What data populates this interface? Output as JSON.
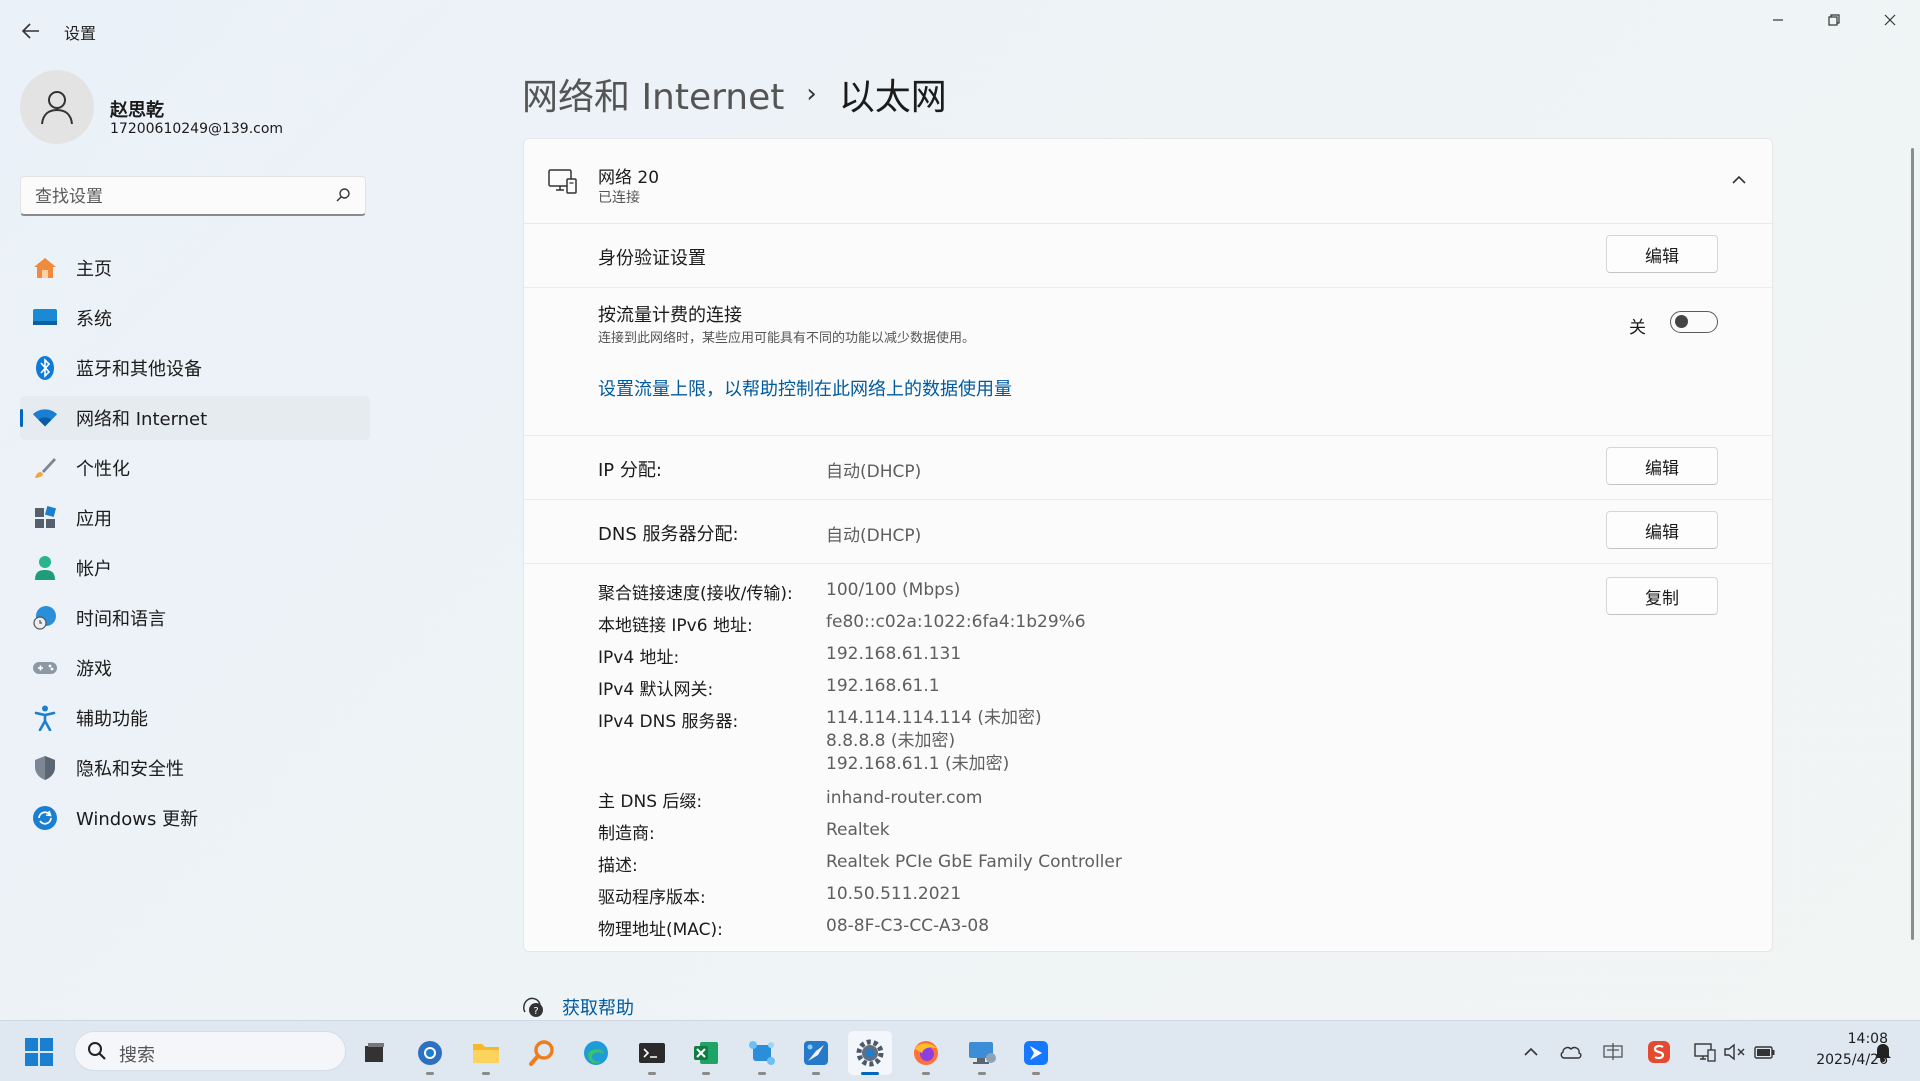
{
  "app": {
    "title": "设置"
  },
  "user": {
    "name": "赵思乾",
    "email": "17200610249@139.com"
  },
  "search": {
    "placeholder": "查找设置"
  },
  "nav": {
    "items": [
      {
        "label": "主页"
      },
      {
        "label": "系统"
      },
      {
        "label": "蓝牙和其他设备"
      },
      {
        "label": "网络和 Internet"
      },
      {
        "label": "个性化"
      },
      {
        "label": "应用"
      },
      {
        "label": "帐户"
      },
      {
        "label": "时间和语言"
      },
      {
        "label": "游戏"
      },
      {
        "label": "辅助功能"
      },
      {
        "label": "隐私和安全性"
      },
      {
        "label": "Windows 更新"
      }
    ],
    "active": "网络和 Internet"
  },
  "breadcrumb": {
    "parent": "网络和 Internet",
    "separator": "›",
    "current": "以太网"
  },
  "network": {
    "name": "网络 20",
    "status": "已连接"
  },
  "auth": {
    "label": "身份验证设置",
    "button": "编辑"
  },
  "metered": {
    "label": "按流量计费的连接",
    "description": "连接到此网络时，某些应用可能具有不同的功能以减少数据使用。",
    "toggle_label": "关",
    "enabled": false,
    "link": "设置流量上限，以帮助控制在此网络上的数据使用量"
  },
  "ip": {
    "label": "IP 分配:",
    "value": "自动(DHCP)",
    "button": "编辑"
  },
  "dns": {
    "label": "DNS 服务器分配:",
    "value": "自动(DHCP)",
    "button": "编辑"
  },
  "details": {
    "copy_button": "复制",
    "rows": [
      {
        "label": "聚合链接速度(接收/传输):",
        "value": "100/100 (Mbps)"
      },
      {
        "label": "本地链接 IPv6 地址:",
        "value": "fe80::c02a:1022:6fa4:1b29%6"
      },
      {
        "label": "IPv4 地址:",
        "value": "192.168.61.131"
      },
      {
        "label": "IPv4 默认网关:",
        "value": "192.168.61.1"
      },
      {
        "label": "IPv4 DNS 服务器:",
        "values": [
          "114.114.114.114 (未加密)",
          "8.8.8.8 (未加密)",
          "192.168.61.1 (未加密)"
        ]
      },
      {
        "label": "主 DNS 后缀:",
        "value": "inhand-router.com"
      },
      {
        "label": "制造商:",
        "value": "Realtek"
      },
      {
        "label": "描述:",
        "value": "Realtek PCIe GbE Family Controller"
      },
      {
        "label": "驱动程序版本:",
        "value": "10.50.511.2021"
      },
      {
        "label": "物理地址(MAC):",
        "value": "08-8F-C3-CC-A3-08"
      }
    ]
  },
  "help": {
    "label": "获取帮助"
  },
  "taskbar": {
    "search_text": "搜索",
    "apps": [
      {
        "name": "task-view"
      },
      {
        "name": "chrome-app"
      },
      {
        "name": "file-explorer"
      },
      {
        "name": "search-app"
      },
      {
        "name": "edge-browser"
      },
      {
        "name": "terminal"
      },
      {
        "name": "excel"
      },
      {
        "name": "network-tool"
      },
      {
        "name": "paint-app"
      },
      {
        "name": "settings-app",
        "active": true
      },
      {
        "name": "firefox"
      },
      {
        "name": "remote-desktop"
      },
      {
        "name": "feishu-app"
      }
    ],
    "time": "14:08",
    "date": "2025/4/26"
  },
  "colors": {
    "accent": "#0067c0",
    "link": "#005a9e",
    "taskbar": "#dfe8f1"
  }
}
